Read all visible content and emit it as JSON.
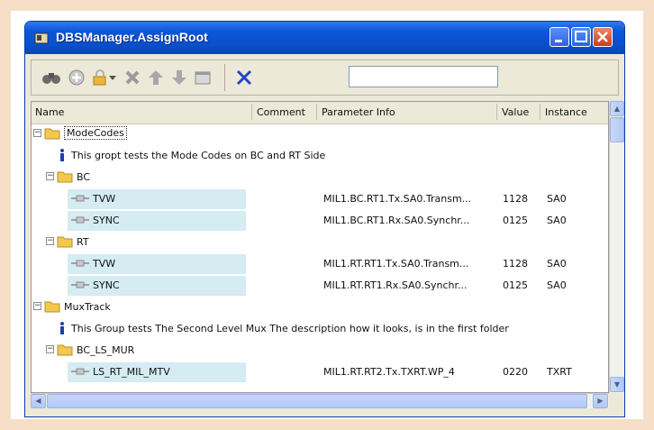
{
  "window": {
    "title": "DBSManager.AssignRoot"
  },
  "toolbar": {
    "icons": [
      "binoculars-icon",
      "add-icon",
      "lock-icon",
      "dropdown-icon",
      "delete-icon",
      "up-arrow-icon",
      "down-arrow-icon",
      "window-icon",
      "close-x-icon"
    ],
    "search_value": ""
  },
  "columns": {
    "name": "Name",
    "comment": "Comment",
    "param": "Parameter Info",
    "value": "Value",
    "instance": "Instance"
  },
  "rows": [
    {
      "kind": "folder",
      "level": 0,
      "name": "ModeCodes",
      "selected": true
    },
    {
      "kind": "info",
      "level": 1,
      "name": "This gropt tests the Mode Codes on BC and RT Side"
    },
    {
      "kind": "folder",
      "level": 1,
      "name": "BC"
    },
    {
      "kind": "leaf",
      "level": 2,
      "name": "TVW",
      "param": "MIL1.BC.RT1.Tx.SA0.Transm...",
      "value": "1128",
      "instance": "SA0"
    },
    {
      "kind": "leaf",
      "level": 2,
      "name": "SYNC",
      "param": "MIL1.BC.RT1.Rx.SA0.Synchr...",
      "value": "0125",
      "instance": "SA0"
    },
    {
      "kind": "folder",
      "level": 1,
      "name": "RT"
    },
    {
      "kind": "leaf",
      "level": 2,
      "name": "TVW",
      "param": "MIL1.RT.RT1.Tx.SA0.Transm...",
      "value": "1128",
      "instance": "SA0"
    },
    {
      "kind": "leaf",
      "level": 2,
      "name": "SYNC",
      "param": "MIL1.RT.RT1.Rx.SA0.Synchr...",
      "value": "0125",
      "instance": "SA0"
    },
    {
      "kind": "folder",
      "level": 0,
      "name": "MuxTrack"
    },
    {
      "kind": "info",
      "level": 1,
      "name": "This Group tests The Second Level Mux The description how it looks, is in the first folder"
    },
    {
      "kind": "folder",
      "level": 1,
      "name": "BC_LS_MUR"
    },
    {
      "kind": "leaf",
      "level": 2,
      "name": "LS_RT_MIL_MTV",
      "param": "MIL1.RT.RT2.Tx.TXRT.WP_4",
      "value": "0220",
      "instance": "TXRT"
    }
  ],
  "colors": {
    "title_bar": "#0b56d9",
    "highlight": "#d4ecf2",
    "folder": "#f2c94c"
  }
}
